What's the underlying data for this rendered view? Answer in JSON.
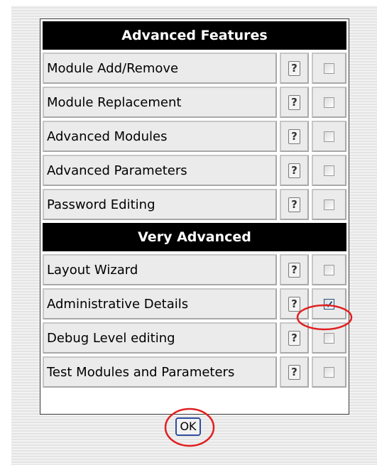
{
  "colors": {
    "header_bg": "#000000",
    "header_text": "#ffffff",
    "cell_bg": "#ebebeb",
    "checkmark": "#1c5180",
    "annotation": "#e02020"
  },
  "sections": [
    {
      "title": "Advanced Features",
      "rows": [
        {
          "label": "Module Add/Remove",
          "help": "?",
          "checked": false
        },
        {
          "label": "Module Replacement",
          "help": "?",
          "checked": false
        },
        {
          "label": "Advanced Modules",
          "help": "?",
          "checked": false
        },
        {
          "label": "Advanced Parameters",
          "help": "?",
          "checked": false
        },
        {
          "label": "Password Editing",
          "help": "?",
          "checked": false
        }
      ]
    },
    {
      "title": "Very Advanced",
      "rows": [
        {
          "label": "Layout Wizard",
          "help": "?",
          "checked": false
        },
        {
          "label": "Administrative Details",
          "help": "?",
          "checked": true
        },
        {
          "label": "Debug Level editing",
          "help": "?",
          "checked": false
        },
        {
          "label": "Test Modules and Parameters",
          "help": "?",
          "checked": false
        }
      ]
    }
  ],
  "ok_button": {
    "label": "OK"
  },
  "annotations": [
    {
      "target": "administrative-details-checkbox",
      "shape": "ellipse"
    },
    {
      "target": "ok-button",
      "shape": "ellipse"
    }
  ]
}
